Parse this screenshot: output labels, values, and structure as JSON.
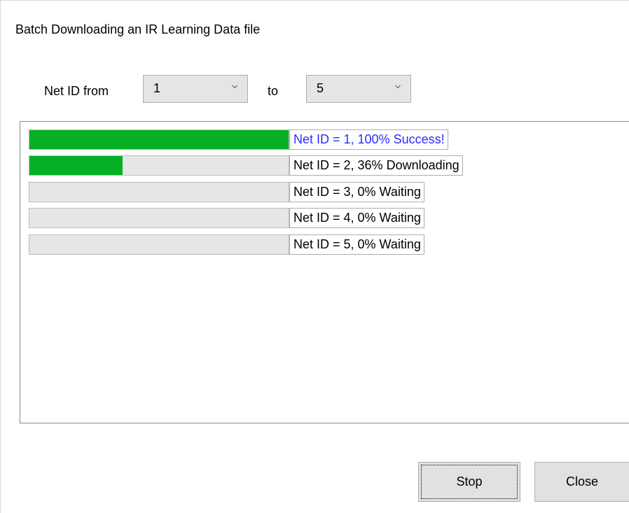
{
  "window": {
    "title": "Batch Downloading an IR Learning Data file"
  },
  "range": {
    "from_label": "Net ID from",
    "from_value": "1",
    "to_label": "to",
    "to_value": "5"
  },
  "items": [
    {
      "progress": 1.0,
      "text": "Net ID = 1, 100% Success!",
      "state": "success"
    },
    {
      "progress": 0.36,
      "text": "Net ID = 2, 36% Downloading",
      "state": "downloading"
    },
    {
      "progress": 0.0,
      "text": "Net ID = 3, 0% Waiting",
      "state": "waiting"
    },
    {
      "progress": 0.0,
      "text": "Net ID = 4, 0% Waiting",
      "state": "waiting"
    },
    {
      "progress": 0.0,
      "text": "Net ID = 5, 0% Waiting",
      "state": "waiting"
    }
  ],
  "buttons": {
    "stop_label": "Stop",
    "close_label": "Close"
  },
  "icons": {
    "dropdown": "chevron-down-icon"
  },
  "colors": {
    "progress_fill": "#06b025",
    "success_text": "#2b2bff"
  }
}
